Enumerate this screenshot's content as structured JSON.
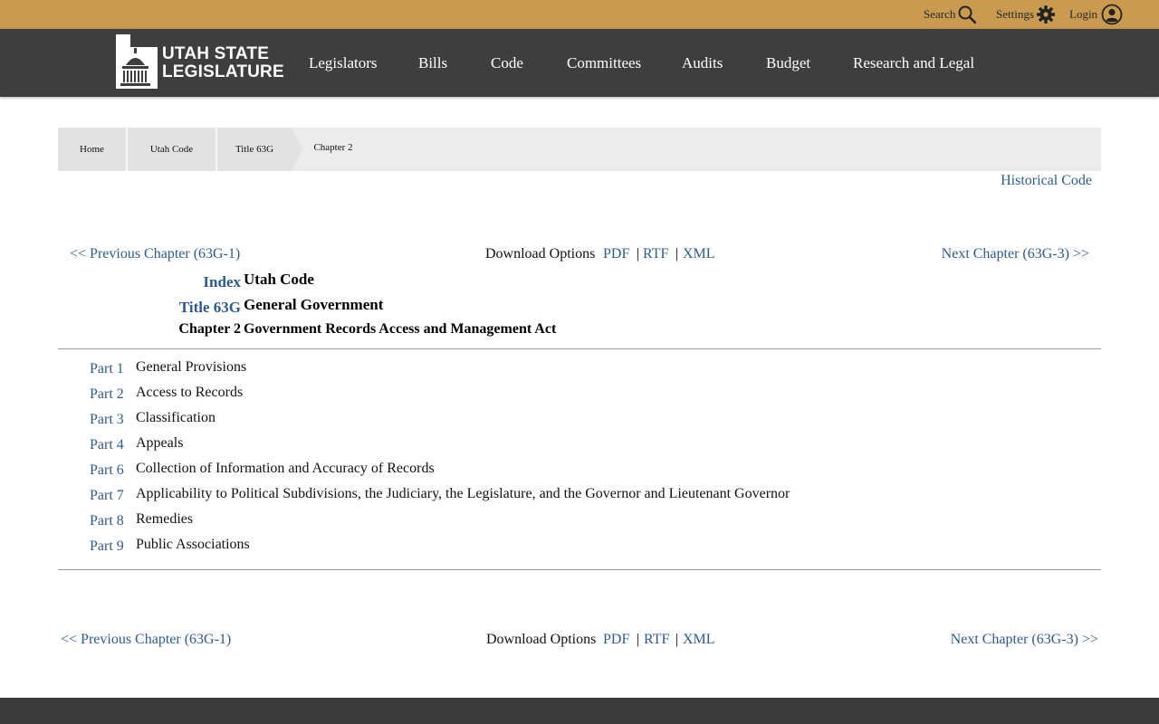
{
  "utility": {
    "search_label": "Search",
    "settings_label": "Settings",
    "login_label": "Login"
  },
  "logo": {
    "line1": "UTAH STATE",
    "line2": "LEGISLATURE"
  },
  "nav": {
    "items": [
      "Legislators",
      "Bills",
      "Code",
      "Committees",
      "Audits",
      "Budget",
      "Research and Legal"
    ]
  },
  "breadcrumb": [
    "Home",
    "Utah Code",
    "Title 63G",
    "Chapter 2"
  ],
  "historical_code": "Historical Code",
  "chapter_nav": {
    "prev": "<< Previous Chapter (63G-1)",
    "next": "Next Chapter (63G-3) >>",
    "download_label": "Download Options",
    "pdf": "PDF",
    "rtf": "RTF",
    "xml": "XML",
    "sep": "|"
  },
  "header": {
    "index_link": "Index",
    "index_value": "Utah Code",
    "title_link": "Title 63G",
    "title_value": "General Government",
    "chapter_label": "Chapter 2",
    "chapter_value": "Government Records Access and Management Act"
  },
  "parts": [
    {
      "num": "Part 1",
      "title": "General Provisions"
    },
    {
      "num": "Part 2",
      "title": "Access to Records"
    },
    {
      "num": "Part 3",
      "title": "Classification"
    },
    {
      "num": "Part 4",
      "title": "Appeals"
    },
    {
      "num": "Part 6",
      "title": "Collection of Information and Accuracy of Records"
    },
    {
      "num": "Part 7",
      "title": "Applicability to Political Subdivisions, the Judiciary, the Legislature, and the Governor and Lieutenant Governor"
    },
    {
      "num": "Part 8",
      "title": "Remedies"
    },
    {
      "num": "Part 9",
      "title": "Public Associations"
    }
  ],
  "colors": {
    "topbar": "#c99a4f",
    "navbar": "#3e3e3e",
    "link": "#2e5b8a"
  }
}
